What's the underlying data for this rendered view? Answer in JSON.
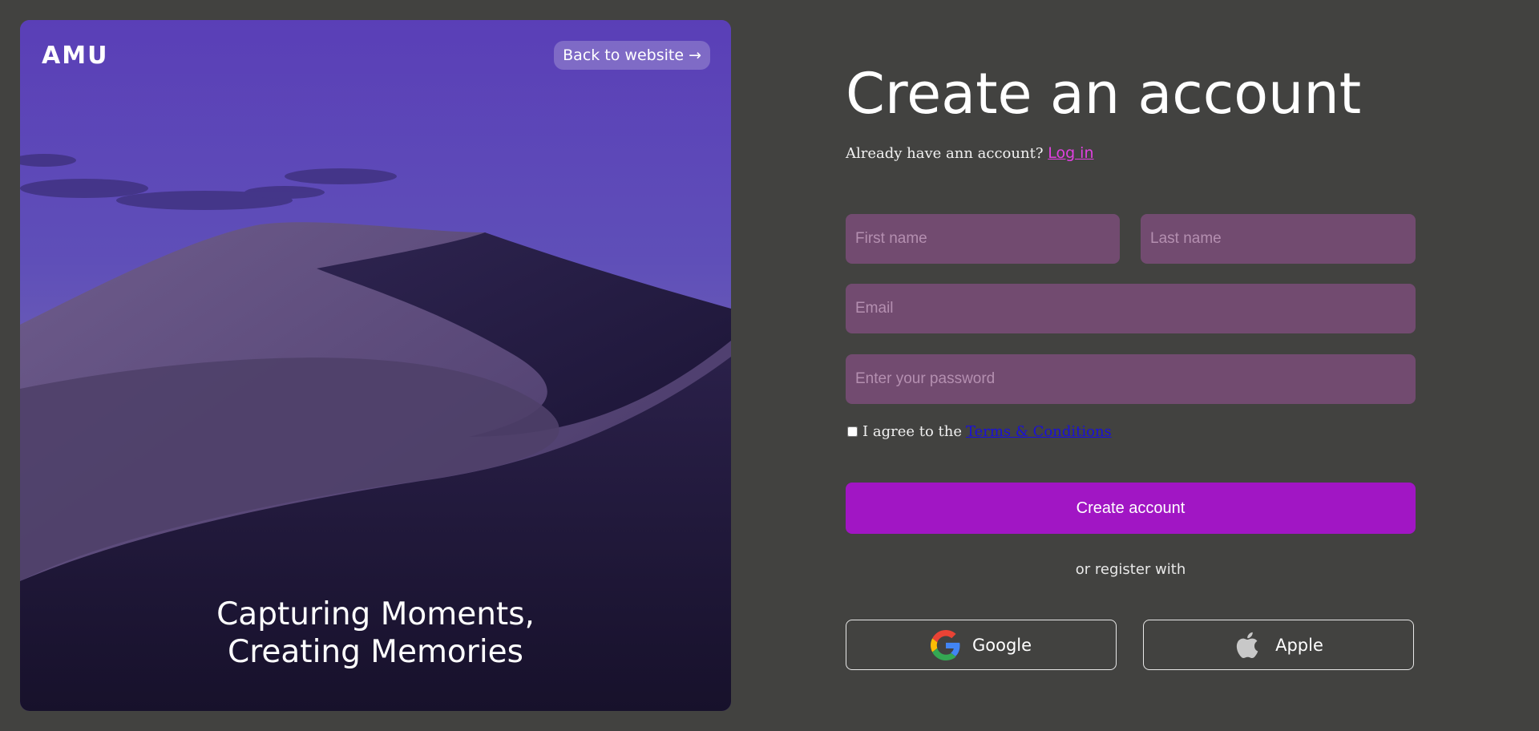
{
  "hero": {
    "logo_text": "AMU",
    "back_label": "Back to website →",
    "tagline_line1": "Capturing Moments,",
    "tagline_line2": "Creating Memories"
  },
  "form": {
    "title": "Create an account",
    "login_prompt": "Already have ann account?",
    "login_link": "Log in",
    "first_name_placeholder": "First name",
    "last_name_placeholder": "Last name",
    "email_placeholder": "Email",
    "password_placeholder": "Enter your password",
    "terms_prefix": "I agree to the",
    "terms_link": "Terms & Conditions",
    "terms_checked": false,
    "create_label": "Create account",
    "or_text": "or register with",
    "google_label": "Google",
    "apple_label": "Apple"
  },
  "colors": {
    "background": "#424240",
    "input_bg": "#724b70",
    "accent_button": "#a116c4",
    "link_pink": "#e040e0",
    "terms_link": "#1a10d8"
  },
  "icons": {
    "google": "google-logo-icon",
    "apple": "apple-logo-icon"
  }
}
